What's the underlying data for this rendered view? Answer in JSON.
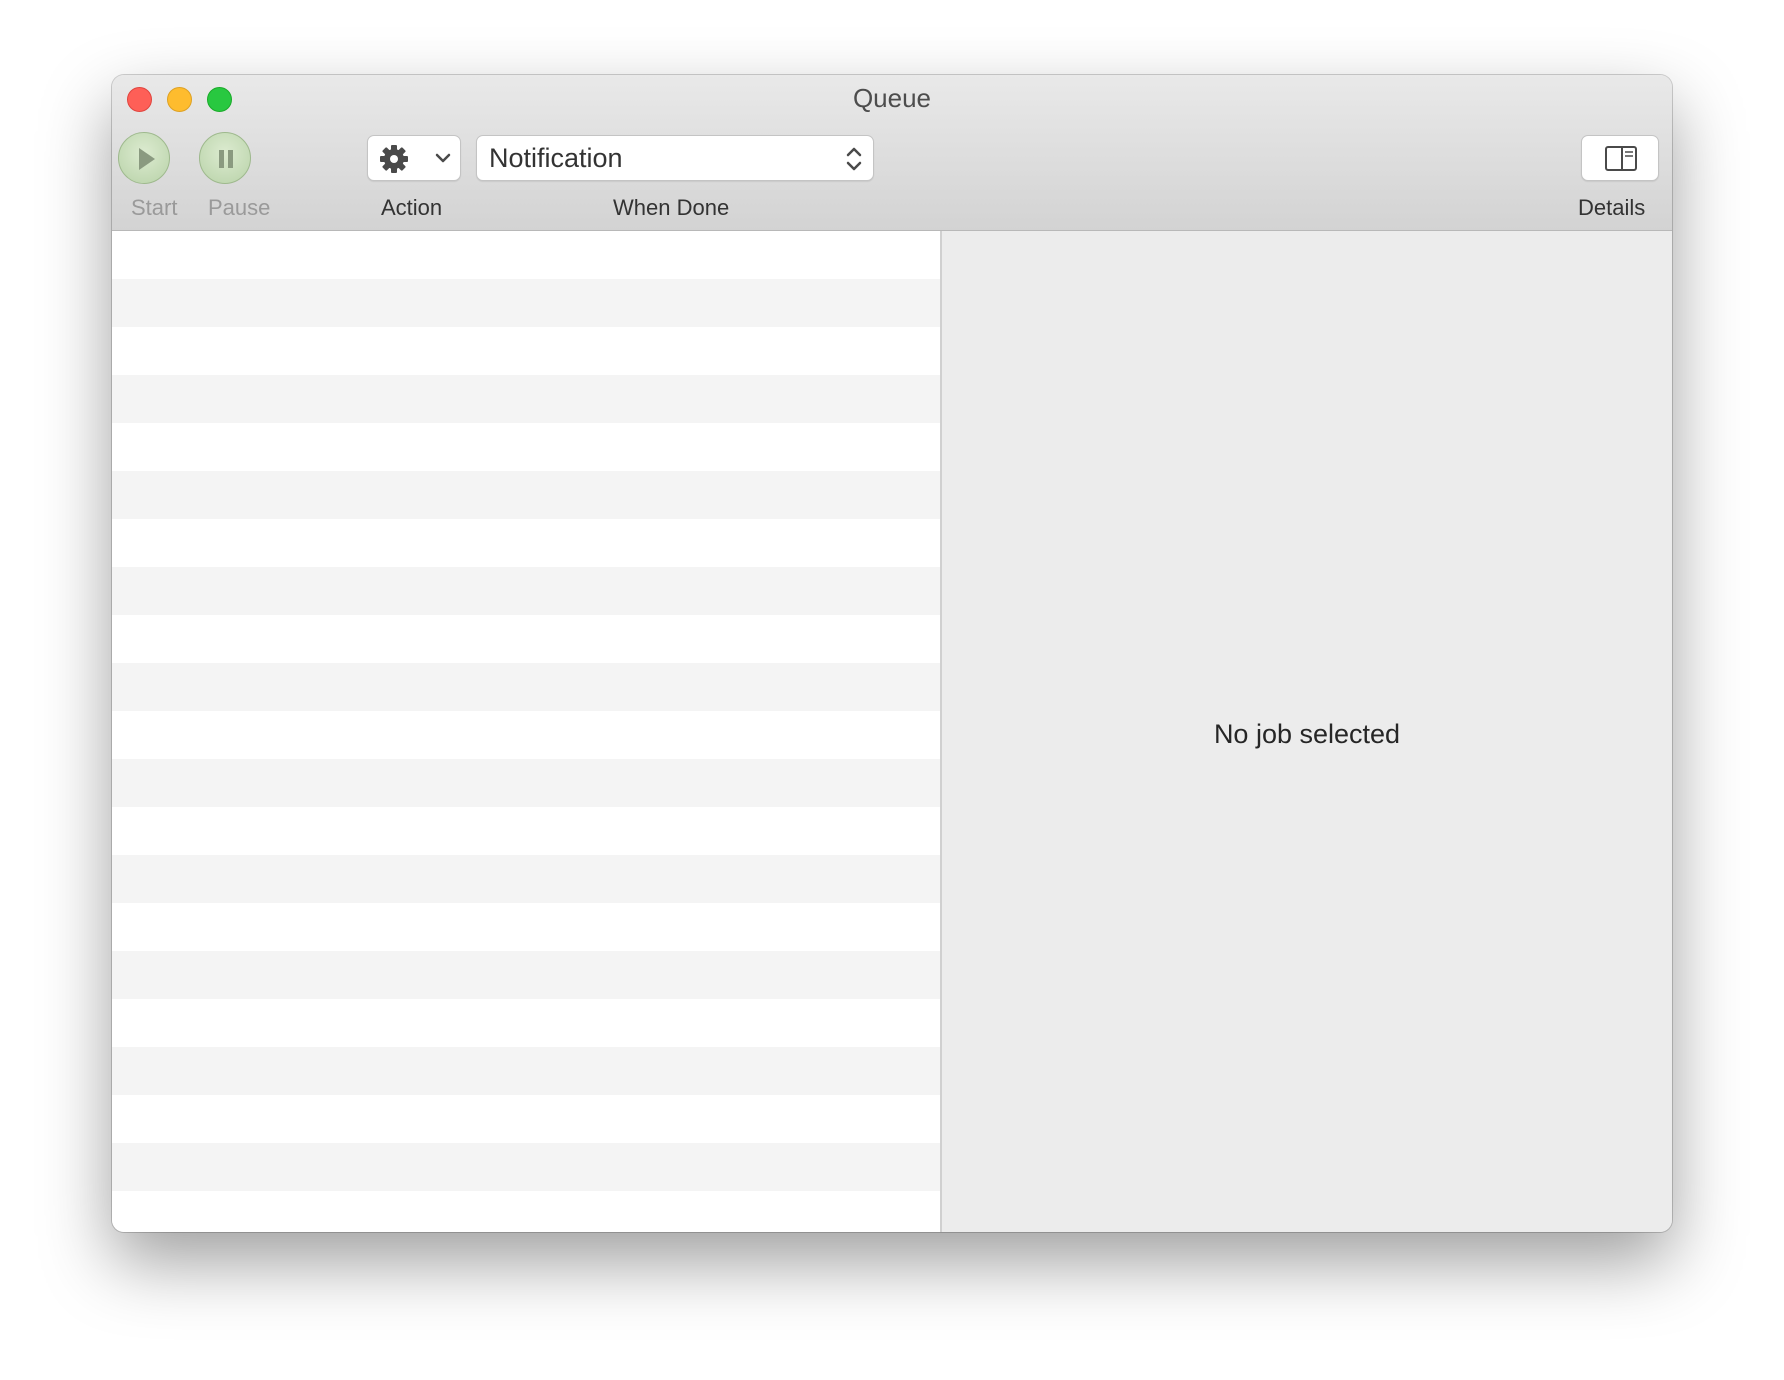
{
  "window": {
    "title": "Queue"
  },
  "toolbar": {
    "start_label": "Start",
    "pause_label": "Pause",
    "action_label": "Action",
    "when_done_label": "When Done",
    "when_done_value": "Notification",
    "details_label": "Details",
    "start_icon": "play-icon",
    "pause_icon": "pause-icon",
    "action_icon": "gear-icon",
    "details_icon": "sidebar-toggle-icon"
  },
  "details_pane": {
    "empty_message": "No job selected"
  },
  "colors": {
    "close": "#fe5f57",
    "minimize": "#febc2e",
    "zoom": "#28c840",
    "run_buttons": "#c7dcb8"
  }
}
